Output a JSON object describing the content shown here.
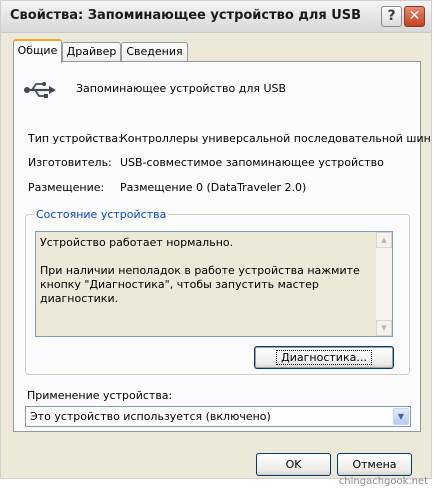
{
  "window": {
    "title": "Свойства: Запоминающее устройство для USB",
    "help_label": "?",
    "close_label": "✕"
  },
  "tabs": [
    {
      "label": "Общие",
      "active": true
    },
    {
      "label": "Драйвер",
      "active": false
    },
    {
      "label": "Сведения",
      "active": false
    }
  ],
  "device": {
    "icon": "usb-icon",
    "name": "Запоминающее устройство для USB"
  },
  "properties": [
    {
      "label": "Тип устройства:",
      "value": "Контроллеры универсальной последовательной шин"
    },
    {
      "label": "Изготовитель:",
      "value": "USB-совместимое запоминающее устройство"
    },
    {
      "label": "Размещение:",
      "value": "Размещение 0 (DataTraveler 2.0)"
    }
  ],
  "status": {
    "group_title": "Состояние устройства",
    "line1": "Устройство работает нормально.",
    "line2": "При наличии неполадок в работе устройства нажмите кнопку \"Диагностика\", чтобы запустить мастер диагностики.",
    "scroll_up": "▲",
    "scroll_down": "▼",
    "diagnostics_button": "Диагностика..."
  },
  "usage": {
    "label": "Применение устройства:",
    "selected": "Это устройство используется (включено)",
    "arrow": "▼"
  },
  "buttons": {
    "ok": "OK",
    "cancel": "Отмена"
  },
  "watermark": "chingachgook.net",
  "colors": {
    "accent_tab": "#f5a623",
    "group_title": "#0046d5",
    "close_button": "#c6401e",
    "dialog_bg": "#ece9d8"
  }
}
